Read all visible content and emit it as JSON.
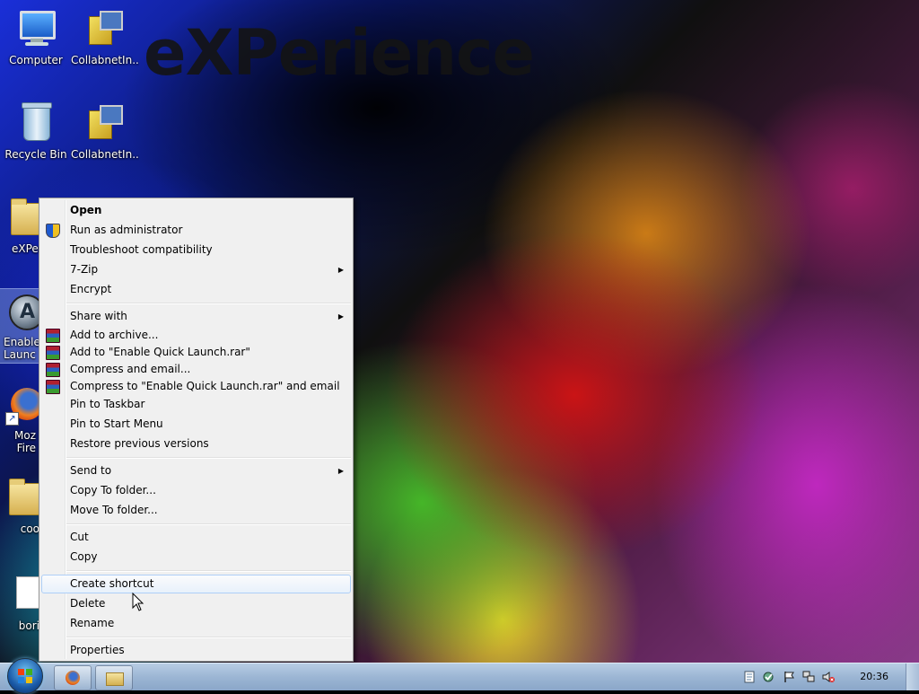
{
  "desktop": {
    "watermark": "eXPerience",
    "icons": [
      {
        "label": "Computer"
      },
      {
        "label": "CollabnetIn..."
      },
      {
        "label": "Recycle Bin"
      },
      {
        "label": "CollabnetIn..."
      },
      {
        "label": "eXPeri"
      },
      {
        "label": "Enable Launc"
      },
      {
        "label": "Moz Fire"
      },
      {
        "label": "coo"
      },
      {
        "label": "bori"
      }
    ]
  },
  "context_menu": {
    "items": [
      {
        "label": "Open",
        "bold": true
      },
      {
        "label": "Run as administrator",
        "icon": "uac-shield-icon"
      },
      {
        "label": "Troubleshoot compatibility"
      },
      {
        "label": "7-Zip",
        "submenu": true
      },
      {
        "label": "Encrypt"
      },
      {
        "label": "Share with",
        "submenu": true
      },
      {
        "label": "Add to archive...",
        "icon": "winrar-icon"
      },
      {
        "label": "Add to \"Enable Quick Launch.rar\"",
        "icon": "winrar-icon"
      },
      {
        "label": "Compress and email...",
        "icon": "winrar-icon"
      },
      {
        "label": "Compress to \"Enable Quick Launch.rar\" and email",
        "icon": "winrar-icon"
      },
      {
        "label": "Pin to Taskbar"
      },
      {
        "label": "Pin to Start Menu"
      },
      {
        "label": "Restore previous versions"
      },
      {
        "label": "Send to",
        "submenu": true
      },
      {
        "label": "Copy To folder..."
      },
      {
        "label": "Move To folder..."
      },
      {
        "label": "Cut"
      },
      {
        "label": "Copy"
      },
      {
        "label": "Create shortcut",
        "highlighted": true
      },
      {
        "label": "Delete"
      },
      {
        "label": "Rename"
      },
      {
        "label": "Properties"
      }
    ]
  },
  "taskbar": {
    "clock": "20:36",
    "pinned": [
      "firefox-icon",
      "folder-icon"
    ],
    "tray_icons": [
      "document-icon",
      "network-check-icon",
      "action-center-flag-icon",
      "network-icon",
      "volume-muted-icon"
    ]
  },
  "colors": {
    "menu_bg": "#f0f0f0",
    "menu_highlight_border": "#aecff7",
    "taskbar": "#9cb6d4"
  }
}
